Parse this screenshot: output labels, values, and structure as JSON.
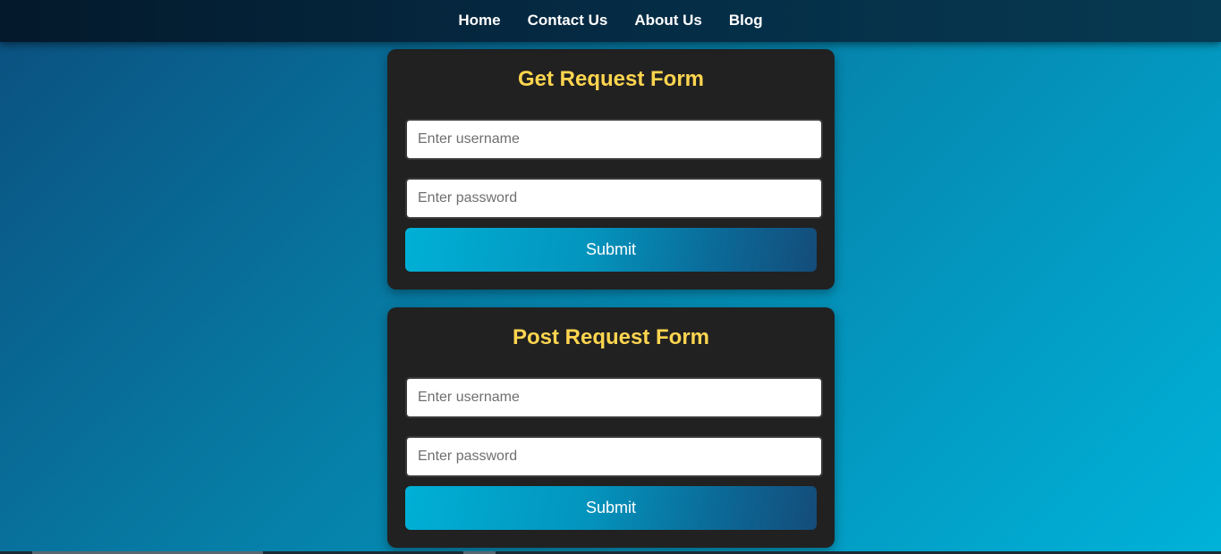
{
  "nav": {
    "items": [
      {
        "label": "Home"
      },
      {
        "label": "Contact Us"
      },
      {
        "label": "About Us"
      },
      {
        "label": "Blog"
      }
    ]
  },
  "forms": [
    {
      "title": "Get Request Form",
      "username": {
        "value": "",
        "placeholder": "Enter username"
      },
      "password": {
        "value": "",
        "placeholder": "Enter password"
      },
      "submit_label": "Submit"
    },
    {
      "title": "Post Request Form",
      "username": {
        "value": "",
        "placeholder": "Enter username"
      },
      "password": {
        "value": "",
        "placeholder": "Enter password"
      },
      "submit_label": "Submit"
    }
  ],
  "colors": {
    "title_accent": "#ffd54f",
    "card_background": "#212121",
    "button_gradient_start": "#00b0d6",
    "button_gradient_end": "#144c7a",
    "navbar_background": "#04192b"
  }
}
